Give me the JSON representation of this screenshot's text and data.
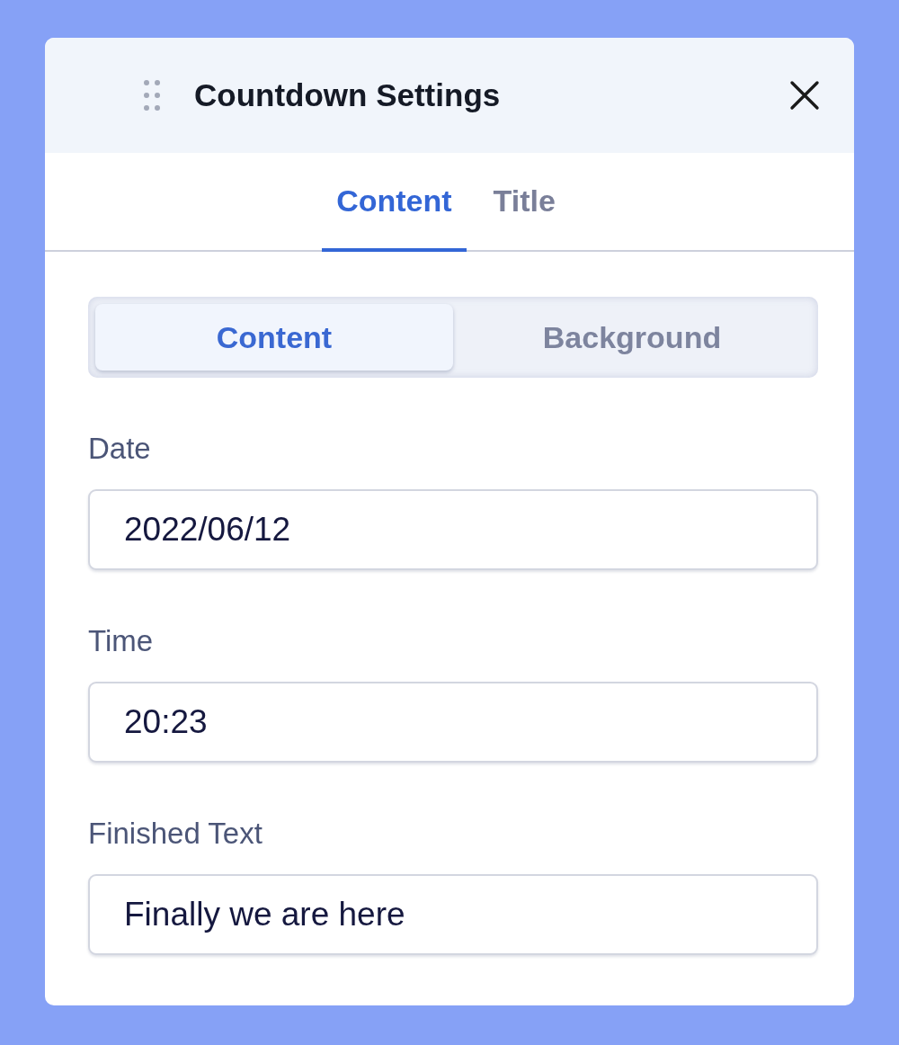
{
  "panel": {
    "title": "Countdown Settings"
  },
  "tabs": [
    {
      "label": "Content",
      "selected": true
    },
    {
      "label": "Title",
      "selected": false
    }
  ],
  "segments": [
    {
      "label": "Content",
      "selected": true
    },
    {
      "label": "Background",
      "selected": false
    }
  ],
  "fields": [
    {
      "label": "Date",
      "value": "2022/06/12"
    },
    {
      "label": "Time",
      "value": "20:23"
    },
    {
      "label": "Finished Text",
      "value": "Finally we are here"
    }
  ]
}
